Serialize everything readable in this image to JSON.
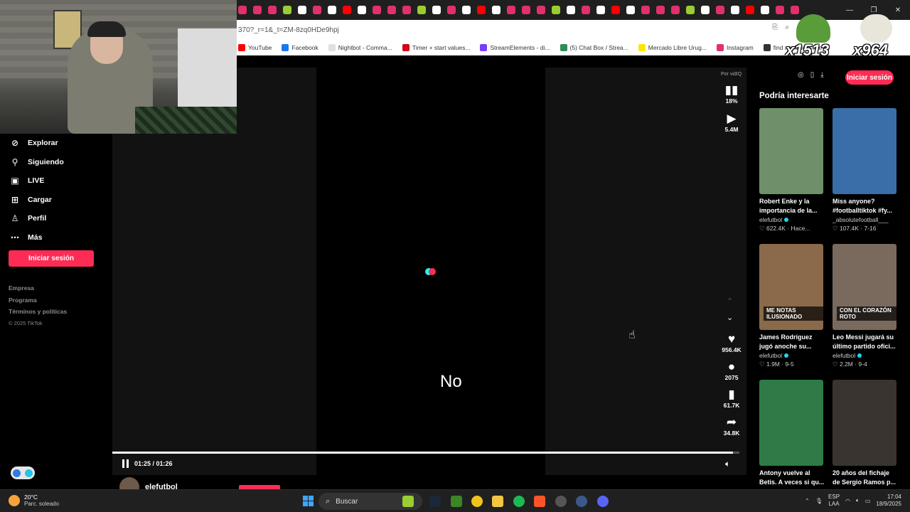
{
  "address": {
    "url_fragment": "370?_r=1&_t=ZM-8zq0HDe9hpj"
  },
  "bookmarks": [
    {
      "label": "YouTube",
      "color": "#ff0000"
    },
    {
      "label": "Facebook",
      "color": "#1877f2"
    },
    {
      "label": "Nightbot - Comma...",
      "color": "#e0e0e0"
    },
    {
      "label": "Timer + start values...",
      "color": "#d0021b"
    },
    {
      "label": "StreamElements - di...",
      "color": "#7a3cff"
    },
    {
      "label": "(5) Chat Box / Strea...",
      "color": "#2e8b57"
    },
    {
      "label": "Mercado Libre Urug...",
      "color": "#ffe600"
    },
    {
      "label": "Instagram",
      "color": "#e1306c"
    },
    {
      "label": "find my look-a-like",
      "color": "#333333"
    }
  ],
  "emote": {
    "count_left": "x1513",
    "count_right": "x964"
  },
  "sidebar": {
    "items": [
      {
        "label": "Explorar",
        "icon": "compass-icon"
      },
      {
        "label": "Siguiendo",
        "icon": "user-follow-icon"
      },
      {
        "label": "LIVE",
        "icon": "live-tv-icon"
      },
      {
        "label": "Cargar",
        "icon": "upload-plus-icon"
      },
      {
        "label": "Perfil",
        "icon": "user-icon"
      },
      {
        "label": "Más",
        "icon": "more-dots-icon"
      }
    ],
    "login_label": "Iniciar sesión",
    "footer": [
      "Empresa",
      "Programa",
      "Términos y políticas"
    ],
    "copyright": "© 2025 TikTok"
  },
  "video": {
    "subtitle": "No",
    "time": "01:25 / 01:26",
    "progress_fraction": 0.99,
    "sponsor_label": "Por vidIQ",
    "stats_percent": "18%",
    "views": "5.4M",
    "likes": "956.4K",
    "comments": "2075",
    "saves": "61.7K",
    "shares": "34.8K",
    "author": "elefutbol"
  },
  "right_panel": {
    "login_label": "Iniciar sesión",
    "section_title": "Podría interesarte",
    "cards": [
      {
        "title": "Robert Enke y la importancia de la...",
        "author": "elefutbol",
        "verified": true,
        "stats": "♡ 622.4K · Hace...",
        "bg": "#6f8f6a"
      },
      {
        "title": "Miss anyone? #footballtiktok #fy...",
        "author": "_absolutefootball___",
        "verified": false,
        "stats": "♡ 107.4K · 7-16",
        "bg": "#3a6ea8"
      },
      {
        "title": "James Rodríguez jugó anoche su...",
        "author": "elefutbol",
        "verified": true,
        "stats": "♡ 1.9M · 9-5",
        "bg": "#8a6a4a",
        "tag": "ME NOTAS ILUSIONADO"
      },
      {
        "title": "Leo Messi jugará su último partido ofici...",
        "author": "elefutbol",
        "verified": true,
        "stats": "♡ 2.2M · 9-4",
        "bg": "#7a6a5e",
        "tag": "CON EL CORAZÓN ROTO"
      },
      {
        "title": "Antony vuelve al Betis. A veces si qu...",
        "author": "",
        "verified": false,
        "stats": "",
        "bg": "#2f7a46"
      },
      {
        "title": "20 años del fichaje de Sergio Ramos p...",
        "author": "",
        "verified": false,
        "stats": "",
        "bg": "#3a3430"
      }
    ]
  },
  "taskbar": {
    "temp": "20°C",
    "weather": "Parc. soleado",
    "search": "Buscar",
    "lang1": "ESP",
    "lang2": "LAA",
    "time": "17:04",
    "date": "18/9/2025"
  }
}
